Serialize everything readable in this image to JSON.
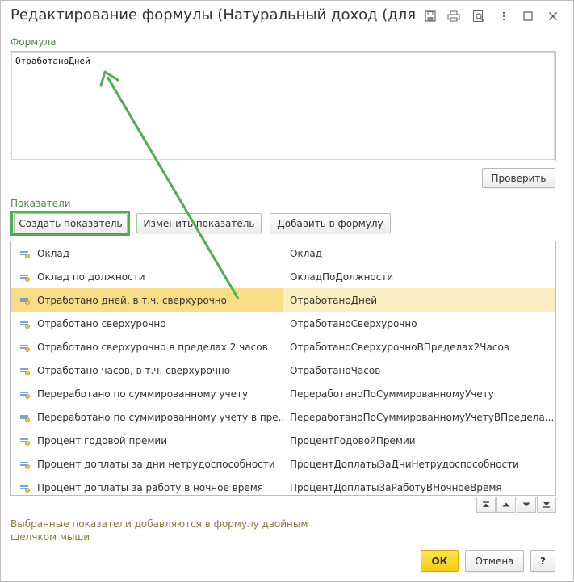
{
  "window": {
    "title": "Редактирование формулы (Натуральный доход (для уд...",
    "buttons": [
      "save-icon",
      "print-icon",
      "preview-icon",
      "more-icon",
      "maximize-icon",
      "close-icon"
    ]
  },
  "formula": {
    "label": "Формула",
    "value": "ОтработаноДней",
    "check_button": "Проверить"
  },
  "indicators": {
    "label": "Показатели",
    "create_button": "Создать показатель",
    "edit_button": "Изменить показатель",
    "add_button": "Добавить в формулу",
    "rows": [
      {
        "name": "Оклад",
        "id": "Оклад"
      },
      {
        "name": "Оклад по должности",
        "id": "ОкладПоДолжности"
      },
      {
        "name": "Отработано дней, в т.ч. сверхурочно",
        "id": "ОтработаноДней"
      },
      {
        "name": "Отработано сверхурочно",
        "id": "ОтработаноСверхурочно"
      },
      {
        "name": "Отработано сверхурочно в пределах 2 часов",
        "id": "ОтработаноСверхурочноВПределах2Часов"
      },
      {
        "name": "Отработано часов, в т.ч. сверхурочно",
        "id": "ОтработаноЧасов"
      },
      {
        "name": "Переработано по суммированному учету",
        "id": "ПереработаноПоСуммированномуУчету"
      },
      {
        "name": "Переработано по суммированному учету в пре...",
        "id": "ПереработаноПоСуммированномуУчетуВПредела..."
      },
      {
        "name": "Процент годовой премии",
        "id": "ПроцентГодовойПремии"
      },
      {
        "name": "Процент доплаты за дни нетрудоспособности",
        "id": "ПроцентДоплатыЗаДниНетрудоспособности"
      },
      {
        "name": "Процент доплаты за работу в ночное время",
        "id": "ПроцентДоплатыЗаРаботуВНочноеВремя"
      }
    ],
    "selected_index": 2
  },
  "nav_buttons": [
    "first-icon",
    "up-icon",
    "down-icon",
    "last-icon"
  ],
  "hint": "Выбранные показатели добавляются в формулу двойным щелчком мыши",
  "footer": {
    "ok": "ОК",
    "cancel": "Отмена",
    "help": "?"
  },
  "colors": {
    "accent_green": "#4caf50",
    "label_green": "#4c8a4f",
    "selected_row": "#fbefc2",
    "ok_yellow": "#f5cd12"
  }
}
